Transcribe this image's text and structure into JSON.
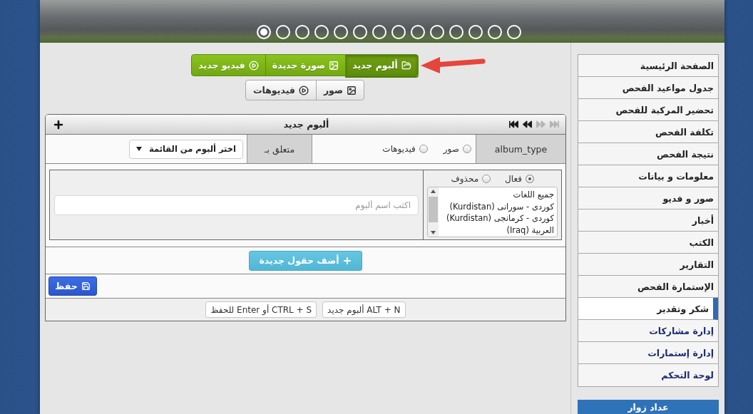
{
  "banner": {
    "slides": [
      {
        "selected": true
      },
      {
        "selected": false
      },
      {
        "selected": false
      },
      {
        "selected": false
      },
      {
        "selected": false
      },
      {
        "selected": false
      },
      {
        "selected": false
      },
      {
        "selected": false
      },
      {
        "selected": false
      },
      {
        "selected": false
      },
      {
        "selected": false
      },
      {
        "selected": false
      },
      {
        "selected": false
      },
      {
        "selected": false
      }
    ]
  },
  "create_buttons": [
    {
      "kind": "album",
      "label": "ألبوم جديد",
      "selected": true
    },
    {
      "kind": "photo",
      "label": "صورة جديدة",
      "selected": false
    },
    {
      "kind": "video",
      "label": "فيديو جديد",
      "selected": false
    }
  ],
  "filter_buttons": [
    {
      "kind": "photo",
      "label": "صور"
    },
    {
      "kind": "video",
      "label": "فيديوهات"
    }
  ],
  "panel": {
    "title": "ألبوم جديد",
    "pager": [
      {
        "kind": "first",
        "disabled": false
      },
      {
        "kind": "previous",
        "disabled": false
      },
      {
        "kind": "next",
        "disabled": true
      },
      {
        "kind": "last",
        "disabled": true
      }
    ],
    "type_label": "album_type",
    "type_options": [
      {
        "label": "صور",
        "selected": false
      },
      {
        "label": "فيديوهات",
        "selected": false
      }
    ],
    "parent_label": "متعلق بـ",
    "parent_select": {
      "value": "اختر ألبوم من القائمة"
    },
    "status_options": [
      {
        "label": "فعال",
        "selected": true
      },
      {
        "label": "محذوف",
        "selected": false
      }
    ],
    "languages": [
      "جميع اللغات",
      "كوردى - سورانى (Kurdistan)",
      "كوردى - كرمانجى (Kurdistan)",
      "العربية (Iraq)"
    ],
    "name_field": {
      "placeholder": "اكتب اسم ألبوم"
    },
    "add_fields_button": "أضف حقول جديدة",
    "save_button": "حفظ",
    "shortcuts": [
      "ALT + N ألبوم جديد",
      "CTRL + S أو Enter للحفظ"
    ]
  },
  "sidebar": {
    "items": [
      {
        "label": "الصفحة الرئيسية",
        "kind": "page",
        "selected": false
      },
      {
        "label": "جدول مواعيد الفحص",
        "kind": "page",
        "selected": false
      },
      {
        "label": "تحضير المركبة للفحص",
        "kind": "page",
        "selected": false
      },
      {
        "label": "تكلفة الفحص",
        "kind": "page",
        "selected": false
      },
      {
        "label": "نتيجة الفحص",
        "kind": "page",
        "selected": false
      },
      {
        "label": "معلومات و بيانات",
        "kind": "page",
        "selected": false
      },
      {
        "label": "صور و فديو",
        "kind": "page",
        "selected": false
      },
      {
        "label": "أخبار",
        "kind": "page",
        "selected": false
      },
      {
        "label": "الكتب",
        "kind": "page",
        "selected": false
      },
      {
        "label": "التقارير",
        "kind": "page",
        "selected": false
      },
      {
        "label": "الإستمارة الفحص",
        "kind": "page",
        "selected": false
      },
      {
        "label": "شكر وتقدير",
        "kind": "page",
        "selected": true
      },
      {
        "label": "إدارة مشاركات",
        "kind": "admin",
        "selected": false
      },
      {
        "label": "إدارة إستمارات",
        "kind": "admin",
        "selected": false
      },
      {
        "label": "لوحة التحكم",
        "kind": "admin",
        "selected": false
      }
    ],
    "counter_title": "عداد زوار"
  }
}
